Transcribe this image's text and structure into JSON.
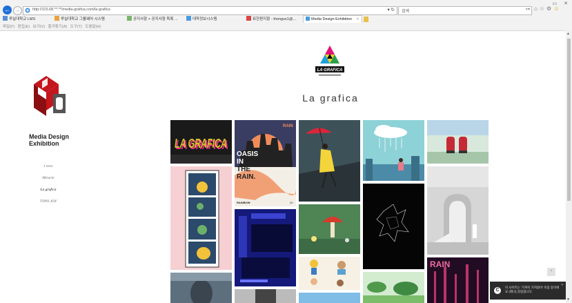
{
  "browser": {
    "url": "http://115.68.**.**/media-grafica.com/la-grafica",
    "search_text": "검색",
    "favorites": [
      "루실대학교 LMS",
      "루실대학교 그룹웨어 시스템",
      "공지사항 > 공지사항 목록 ...",
      "대학정보시스템",
      "표현편지함 - thongus1@...",
      ""
    ],
    "active_tab": "Media Design Exhibition",
    "menu": "파일(F)  편집(E)  보기(V)  즐겨찾기(A)  도구(T)  도움말(H)"
  },
  "site": {
    "title": "Media Design Exhibition",
    "nav": [
      "I view",
      "Miracle",
      "La grafica",
      "TYPO JOY"
    ],
    "active_nav": "La grafica"
  },
  "gallery": {
    "heading": "La grafica",
    "logo_text": "LA GRAFICA",
    "tile_texts": {
      "lagrafica": "LA GRAFICA",
      "oasis_title": "OASIS IN THE RAIN",
      "oasis_corner": "RAIN",
      "oasis_brand": "RAINBOW",
      "oasis_num": "20",
      "rain_big": "RAIN"
    }
  },
  "ui": {
    "scroll_top_label": "^",
    "notification": "이 사이트는 '가까이 가져왔어' 이용 중이에요 (배너) 알림합니다."
  },
  "colors": {
    "ie_blue": "#1e6fd9",
    "brand_red": "#c4161c",
    "toast_bg": "#2b2b2b"
  }
}
